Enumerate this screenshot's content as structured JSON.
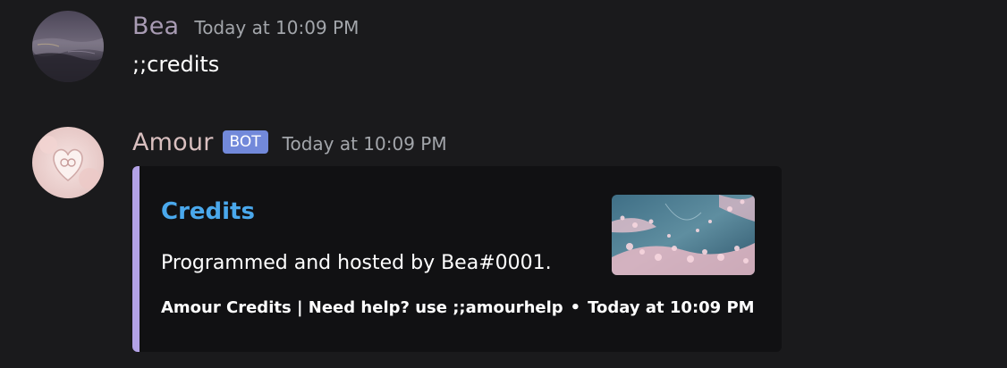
{
  "messages": [
    {
      "username": "Bea",
      "username_color": "#a89bb3",
      "timestamp": "Today at 10:09 PM",
      "content": ";;credits"
    },
    {
      "username": "Amour",
      "username_color": "#d9bfbf",
      "bot_tag": "BOT",
      "timestamp": "Today at 10:09 PM",
      "embed": {
        "accent_color": "#b3a2e6",
        "title": "Credits",
        "description": "Programmed and hosted by Bea#0001.",
        "footer_text": "Amour Credits | Need help? use ;;amourhelp",
        "footer_separator": "•",
        "footer_timestamp": "Today at 10:09 PM"
      }
    }
  ],
  "icons": {
    "bea_avatar": "avatar-image-icon",
    "amour_avatar": "avatar-image-icon",
    "embed_thumbnail": "cherry-blossom-thumbnail"
  },
  "colors": {
    "background": "#1a1a1c",
    "embed_background": "#111113",
    "title_link": "#4aa8ec",
    "timestamp": "#a3a6ab",
    "bot_tag": "#7289da"
  }
}
